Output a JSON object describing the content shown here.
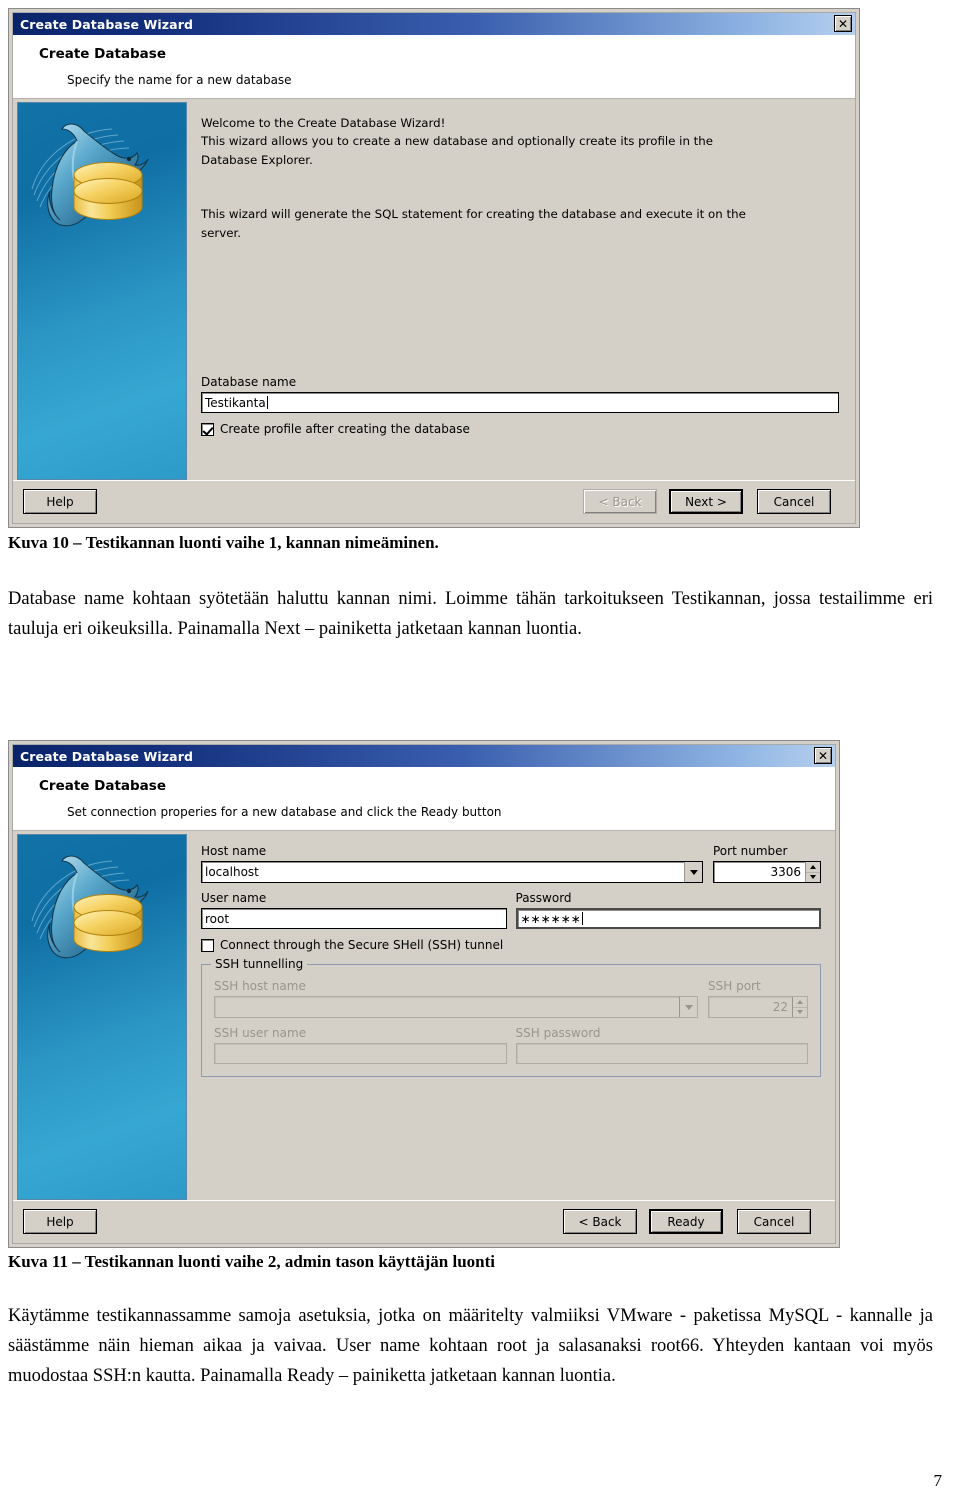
{
  "page": {
    "number": "7"
  },
  "figure1": {
    "dialog": {
      "titlebar": "Create Database Wizard",
      "close_label": "✕",
      "header_title": "Create Database",
      "header_sub": "Specify the name for a new database",
      "welcome_text": "Welcome to the Create Database Wizard!\nThis wizard allows you to create a new database and optionally create its profile in the\nDatabase Explorer.\n\n\nThis wizard will generate the SQL statement for creating the database and execute it on the\nserver.",
      "db_name_label": "Database name",
      "db_name_value": "Testikanta",
      "create_profile_label": "Create profile after creating the database",
      "create_profile_checked": true,
      "buttons": {
        "help": "Help",
        "back": "< Back",
        "next": "Next >",
        "cancel": "Cancel"
      }
    },
    "caption": "Kuva 10 – Testikannan luonti vaihe 1, kannan nimeäminen.",
    "paragraph": "Database name kohtaan syötetään haluttu kannan nimi. Loimme tähän tarkoitukseen Testikannan, jossa testailimme eri tauluja eri oikeuksilla. Painamalla Next – painiketta jatketaan kannan luontia."
  },
  "figure2": {
    "dialog": {
      "titlebar": "Create Database Wizard",
      "close_label": "✕",
      "header_title": "Create Database",
      "header_sub": "Set connection properies for a new database and click the Ready button",
      "host_label": "Host name",
      "host_value": "localhost",
      "port_label": "Port number",
      "port_value": "3306",
      "user_label": "User name",
      "user_value": "root",
      "password_label": "Password",
      "password_value": "∗∗∗∗∗∗",
      "ssh_checkbox_label": "Connect through the Secure SHell (SSH) tunnel",
      "ssh_checkbox_checked": false,
      "ssh_group_title": "SSH tunnelling",
      "ssh_host_label": "SSH host name",
      "ssh_host_value": "",
      "ssh_port_label": "SSH port",
      "ssh_port_value": "22",
      "ssh_user_label": "SSH user name",
      "ssh_user_value": "",
      "ssh_password_label": "SSH password",
      "ssh_password_value": "",
      "buttons": {
        "help": "Help",
        "back": "< Back",
        "ready": "Ready",
        "cancel": "Cancel"
      }
    },
    "caption": "Kuva 11 – Testikannan luonti vaihe 2, admin tason käyttäjän luonti",
    "paragraph": "Käytämme testikannassamme samoja asetuksia, jotka on määritelty valmiiksi VMware - paketissa MySQL - kannalle ja säästämme näin hieman aikaa ja vaivaa. User name kohtaan root ja salasanaksi root66. Yhteyden kantaan voi myös muodostaa SSH:n kautta. Painamalla Ready – painiketta jatketaan kannan luontia."
  }
}
